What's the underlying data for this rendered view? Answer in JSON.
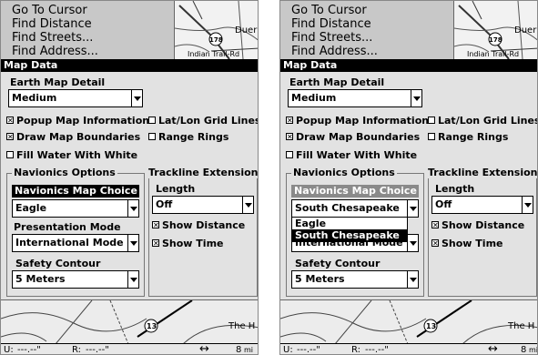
{
  "menu": {
    "items": [
      "Go To Cursor",
      "Find Distance",
      "Find Streets...",
      "Find Address..."
    ]
  },
  "map_labels": {
    "town": "Duer",
    "road_sign": "178",
    "street": "Indian Trail-Rd",
    "bottom_place": "The H",
    "bottom_route": "13"
  },
  "dialog": {
    "title": "Map Data"
  },
  "earth_map_detail": {
    "label": "Earth Map Detail",
    "value": "Medium"
  },
  "checkboxes": {
    "popup": {
      "label": "Popup Map Information",
      "checked": true
    },
    "latlon": {
      "label": "Lat/Lon Grid Lines",
      "checked": false
    },
    "boundaries": {
      "label": "Draw Map Boundaries",
      "checked": true
    },
    "rings": {
      "label": "Range Rings",
      "checked": false
    },
    "fill_water": {
      "label": "Fill Water With White",
      "checked": false
    }
  },
  "navionics": {
    "title": "Navionics Options",
    "map_choice_label": "Navionics Map Choice",
    "left_map_choice": "Eagle",
    "right_map_choice": "South Chesapeake",
    "map_choice_options": [
      "Eagle",
      "South Chesapeake"
    ],
    "presentation_label": "Presentation Mode",
    "presentation_value": "International Mode",
    "safety_label": "Safety Contour",
    "safety_value": "5 Meters"
  },
  "trackline": {
    "title": "Trackline Extensions",
    "length_label": "Length",
    "length_value": "Off",
    "show_distance": {
      "label": "Show Distance",
      "checked": true
    },
    "show_time": {
      "label": "Show Time",
      "checked": true
    }
  },
  "status_bar": {
    "u_label": "U:",
    "u_value": "---.--\"",
    "r_label": "R:",
    "r_value": "---.--\"",
    "arrows": "↔",
    "scale_value": "8",
    "scale_unit": "mi"
  },
  "colors": {
    "selection": "#000000",
    "panel": "#e2e2e2",
    "screen_bg": "#d4d4d4"
  }
}
